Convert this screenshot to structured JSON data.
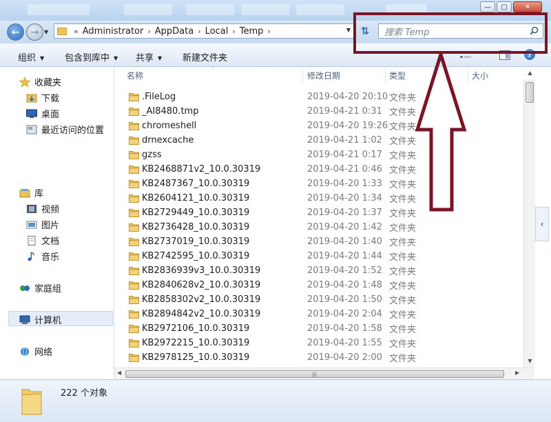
{
  "address": {
    "crumbs": [
      "Administrator",
      "AppData",
      "Local",
      "Temp"
    ],
    "overflow_glyph": "«"
  },
  "search": {
    "placeholder": "搜索 Temp"
  },
  "toolbar": {
    "organize": "组织",
    "include_in_library": "包含到库中",
    "share": "共享",
    "new_folder": "新建文件夹"
  },
  "nav": {
    "favorites": "收藏夹",
    "downloads": "下载",
    "desktop": "桌面",
    "recent": "最近访问的位置",
    "libraries": "库",
    "videos": "视频",
    "pictures": "图片",
    "documents": "文档",
    "music": "音乐",
    "homegroup": "家庭组",
    "computer": "计算机",
    "network": "网络"
  },
  "columns": {
    "name": "名称",
    "date": "修改日期",
    "type": "类型",
    "size": "大小"
  },
  "files": [
    {
      "name": ".FileLog",
      "date": "2019-04-20 20:10",
      "type": "文件夹"
    },
    {
      "name": "_AI8480.tmp",
      "date": "2019-04-21 0:31",
      "type": "文件夹"
    },
    {
      "name": "chromeshell",
      "date": "2019-04-20 19:26",
      "type": "文件夹"
    },
    {
      "name": "drnexcache",
      "date": "2019-04-21 1:02",
      "type": "文件夹"
    },
    {
      "name": "gzss",
      "date": "2019-04-21 0:17",
      "type": "文件夹"
    },
    {
      "name": "KB2468871v2_10.0.30319",
      "date": "2019-04-21 0:46",
      "type": "文件夹"
    },
    {
      "name": "KB2487367_10.0.30319",
      "date": "2019-04-20 1:33",
      "type": "文件夹"
    },
    {
      "name": "KB2604121_10.0.30319",
      "date": "2019-04-20 1:34",
      "type": "文件夹"
    },
    {
      "name": "KB2729449_10.0.30319",
      "date": "2019-04-20 1:37",
      "type": "文件夹"
    },
    {
      "name": "KB2736428_10.0.30319",
      "date": "2019-04-20 1:42",
      "type": "文件夹"
    },
    {
      "name": "KB2737019_10.0.30319",
      "date": "2019-04-20 1:40",
      "type": "文件夹"
    },
    {
      "name": "KB2742595_10.0.30319",
      "date": "2019-04-20 1:44",
      "type": "文件夹"
    },
    {
      "name": "KB2836939v3_10.0.30319",
      "date": "2019-04-20 1:52",
      "type": "文件夹"
    },
    {
      "name": "KB2840628v2_10.0.30319",
      "date": "2019-04-20 1:48",
      "type": "文件夹"
    },
    {
      "name": "KB2858302v2_10.0.30319",
      "date": "2019-04-20 1:50",
      "type": "文件夹"
    },
    {
      "name": "KB2894842v2_10.0.30319",
      "date": "2019-04-20 2:04",
      "type": "文件夹"
    },
    {
      "name": "KB2972106_10.0.30319",
      "date": "2019-04-20 1:58",
      "type": "文件夹"
    },
    {
      "name": "KB2972215_10.0.30319",
      "date": "2019-04-20 1:55",
      "type": "文件夹"
    },
    {
      "name": "KB2978125_10.0.30319",
      "date": "2019-04-20 2:00",
      "type": "文件夹"
    }
  ],
  "status": {
    "object_count": "222 个对象"
  },
  "colors": {
    "annotation": "#7a1526",
    "folder": "#e8c460",
    "chrome": "#c8dbef"
  }
}
